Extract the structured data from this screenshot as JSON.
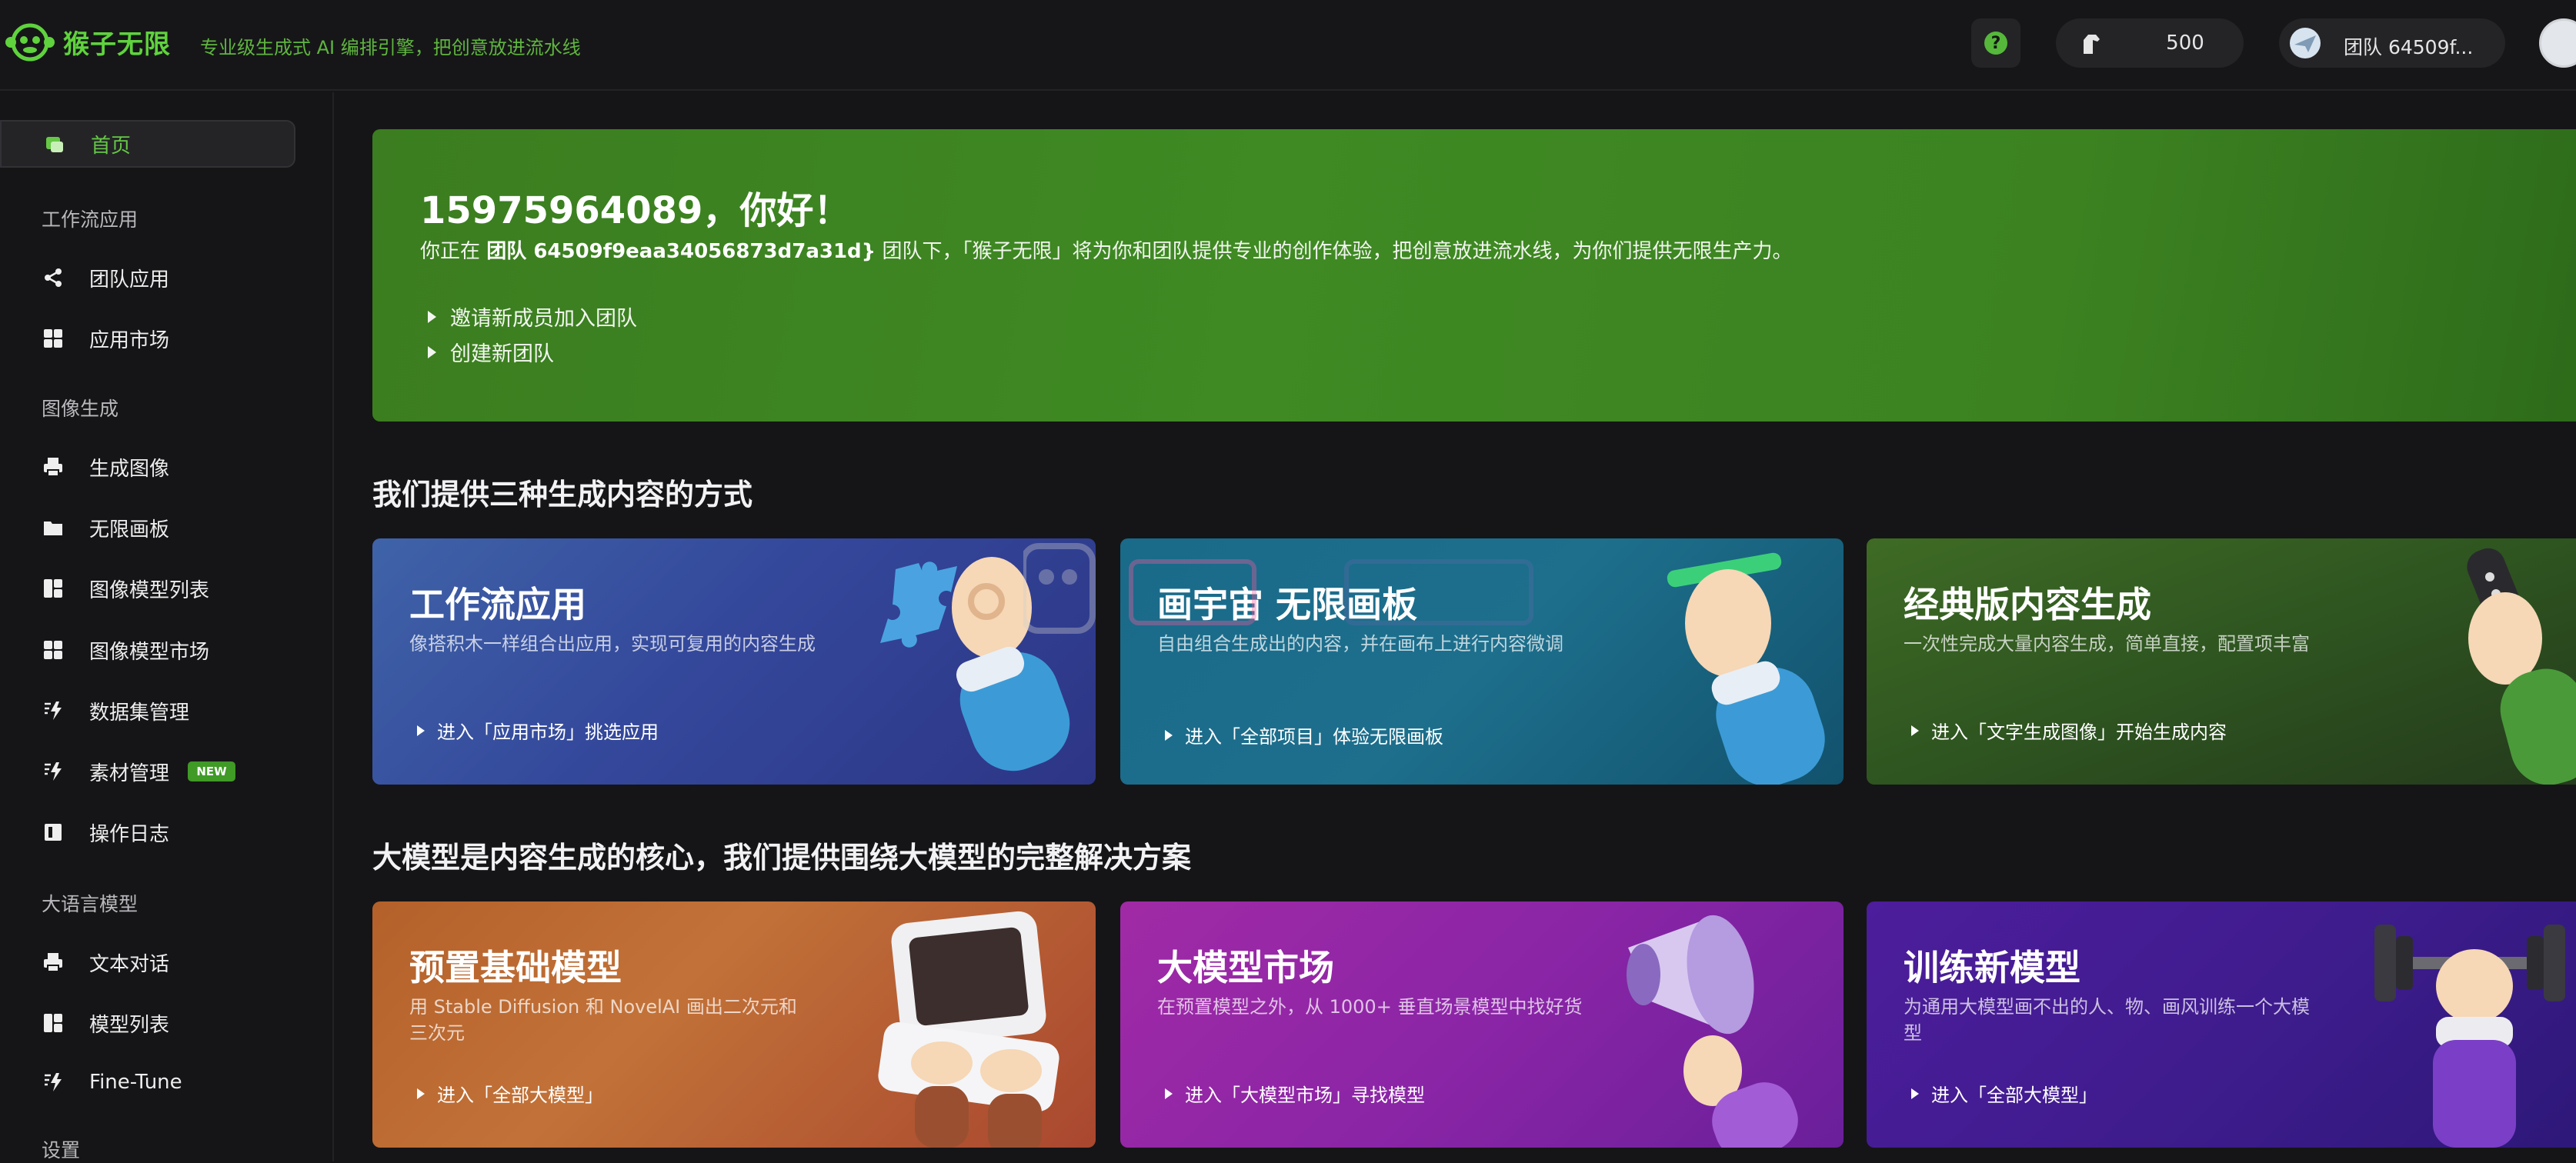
{
  "header": {
    "brand": "猴子无限",
    "slogan": "专业级生成式 AI 编排引擎，把创意放进流水线",
    "credits": "500",
    "team_name": "团队 64509f..."
  },
  "sidebar": {
    "home": "首页",
    "sections": {
      "workflow": "工作流应用",
      "image": "图像生成",
      "llm": "大语言模型",
      "settings": "设置"
    },
    "items": {
      "team_apps": "团队应用",
      "app_market": "应用市场",
      "generate_image": "生成图像",
      "infinite_canvas": "无限画板",
      "image_models": "图像模型列表",
      "image_model_market": "图像模型市场",
      "dataset_mgmt": "数据集管理",
      "material_mgmt": "素材管理",
      "material_badge": "NEW",
      "op_log": "操作日志",
      "text_chat": "文本对话",
      "model_list": "模型列表",
      "fine_tune": "Fine-Tune"
    }
  },
  "hero": {
    "greeting": "15975964089，你好！",
    "desc_prefix": "你正在 ",
    "desc_team": "团队 64509f9eaa34056873d7a31d}",
    "desc_suffix": " 团队下，「猴子无限」将为你和团队提供专业的创作体验，把创意放进流水线，为你们提供无限生产力。",
    "link_invite": "邀请新成员加入团队",
    "link_create": "创建新团队"
  },
  "section1": {
    "title": "我们提供三种生成内容的方式",
    "cards": [
      {
        "title": "工作流应用",
        "subtitle": "像搭积木一样组合出应用，实现可复用的内容生成",
        "link": "进入「应用市场」挑选应用"
      },
      {
        "title": "画宇宙 无限画板",
        "subtitle": "自由组合生成出的内容，并在画布上进行内容微调",
        "link": "进入「全部项目」体验无限画板"
      },
      {
        "title": "经典版内容生成",
        "subtitle": "一次性完成大量内容生成，简单直接，配置项丰富",
        "link": "进入「文字生成图像」开始生成内容"
      }
    ]
  },
  "section2": {
    "title": "大模型是内容生成的核心，我们提供围绕大模型的完整解决方案",
    "cards": [
      {
        "title": "预置基础模型",
        "subtitle": "用 Stable Diffusion 和 NovelAI 画出二次元和三次元",
        "link": "进入「全部大模型」"
      },
      {
        "title": "大模型市场",
        "subtitle": "在预置模型之外，从 1000+ 垂直场景模型中找好货",
        "link": "进入「大模型市场」寻找模型"
      },
      {
        "title": "训练新模型",
        "subtitle": "为通用大模型画不出的人、物、画风训练一个大模型",
        "link": "进入「全部大模型」"
      }
    ]
  },
  "icons": {
    "logo": "monkey-logo-icon",
    "help": "question-icon",
    "credits": "horse-icon",
    "team": "paper-plane-icon"
  },
  "colors": {
    "accent": "#5fd23d",
    "hero_green": "#3f8a23",
    "background": "#151517"
  }
}
